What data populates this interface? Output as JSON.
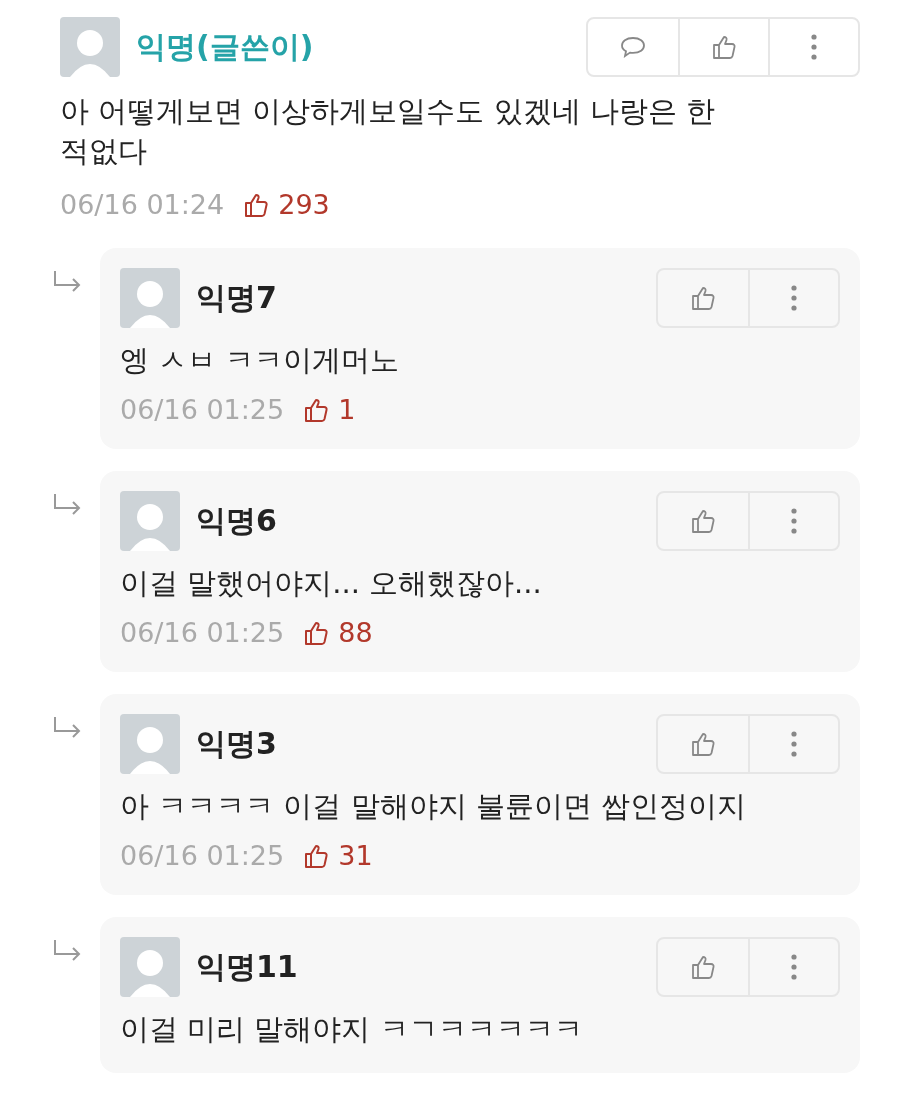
{
  "comment": {
    "author": "익명(글쓴이)",
    "text": "아 어떻게보면 이상하게보일수도 있겠네 나랑은 한적없다",
    "time": "06/16 01:24",
    "likes": "293"
  },
  "replies": [
    {
      "author": "익명7",
      "text": "엥 ㅅㅂ ㅋㅋ이게머노",
      "time": "06/16 01:25",
      "likes": "1"
    },
    {
      "author": "익명6",
      "text": "이걸 말했어야지... 오해했잖아...",
      "time": "06/16 01:25",
      "likes": "88"
    },
    {
      "author": "익명3",
      "text": "아 ㅋㅋㅋㅋ 이걸 말해야지 불륜이면 쌉인정이지",
      "time": "06/16 01:25",
      "likes": "31"
    },
    {
      "author": "익명11",
      "text": "이걸 미리 말해야지 ㅋㄱㅋㅋㅋㅋㅋ"
    }
  ]
}
